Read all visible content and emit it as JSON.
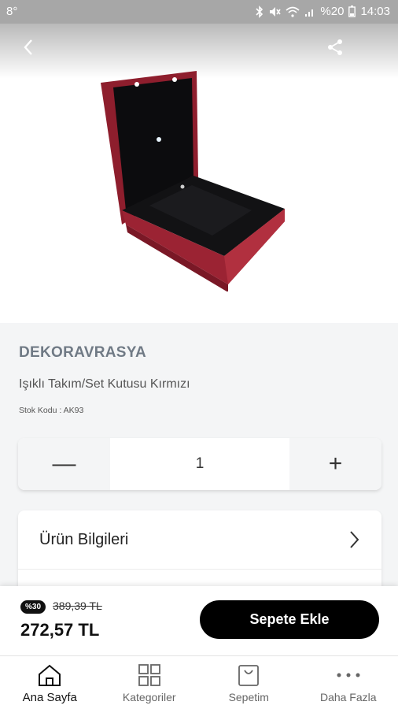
{
  "status_bar": {
    "left_text": "8°",
    "battery": "%20",
    "time": "14:03"
  },
  "product": {
    "brand": "DEKORAVRASYA",
    "name": "Işıklı Takım/Set Kutusu Kırmızı",
    "stock_code": "Stok Kodu : AK93",
    "quantity": "1"
  },
  "quantity_controls": {
    "minus": "—",
    "plus": "+"
  },
  "accordion": {
    "items": [
      {
        "label": "Ürün Bilgileri"
      }
    ]
  },
  "purchase": {
    "discount_badge": "%30",
    "old_price": "389,39 TL",
    "price": "272,57 TL",
    "add_to_cart": "Sepete Ekle"
  },
  "nav": {
    "items": [
      {
        "label": "Ana Sayfa",
        "icon": "home-icon",
        "active": true
      },
      {
        "label": "Kategoriler",
        "icon": "grid-icon"
      },
      {
        "label": "Sepetim",
        "icon": "cart-bag-icon"
      },
      {
        "label": "Daha Fazla",
        "icon": "more-dots-icon"
      }
    ]
  },
  "colors": {
    "accent": "#000000",
    "brand_text": "#707a85",
    "background": "#f4f5f6",
    "box_red": "#a3273a"
  }
}
